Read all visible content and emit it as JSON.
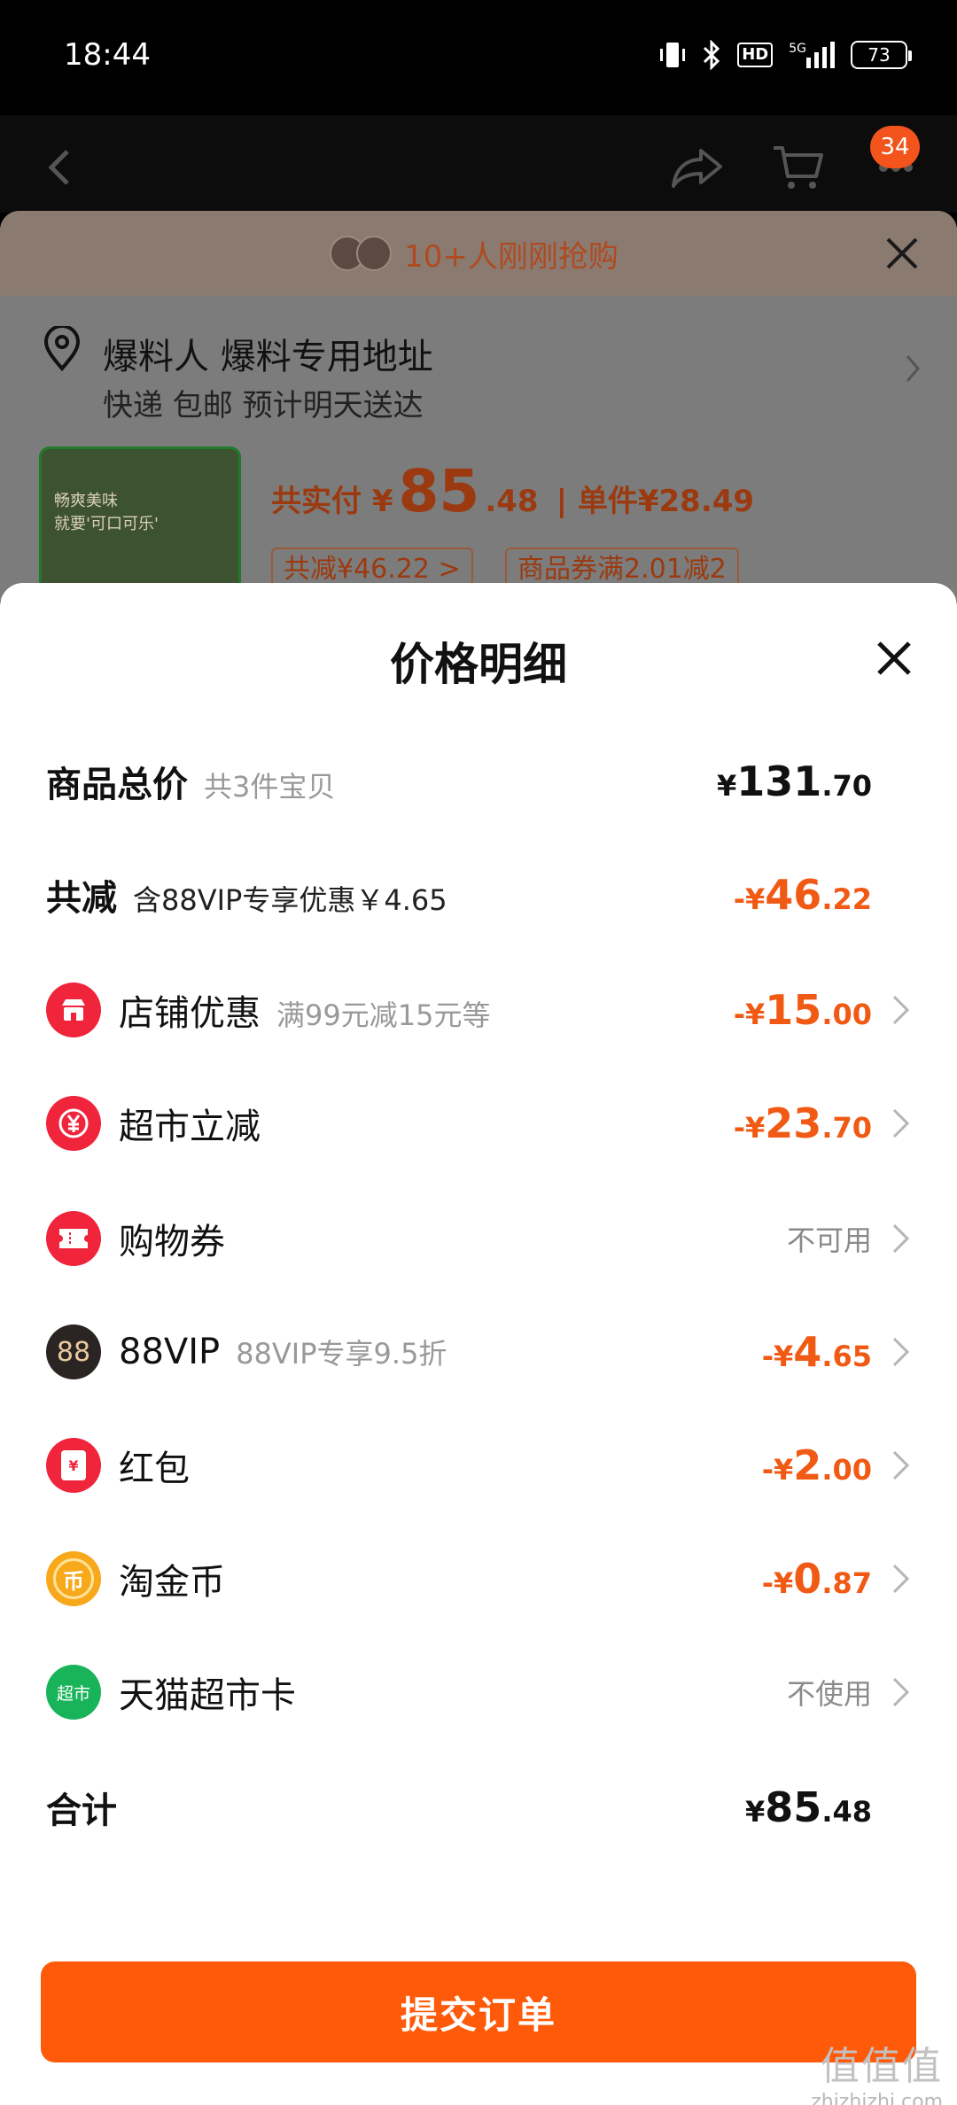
{
  "status_bar": {
    "time": "18:44",
    "network": "5G",
    "hd": "HD",
    "battery": "73"
  },
  "nav": {
    "cart_badge": "34"
  },
  "background_page": {
    "banner_text": "10+人刚刚抢购",
    "address_name": "爆料人 爆料专用地址",
    "shipping": "快递 包邮 预计明天送达",
    "paid_label": "共实付 ¥",
    "paid_int": "85",
    "paid_dec": ".48",
    "unit_price": "| 单件¥28.49",
    "chip_discount": "共减¥46.22 >",
    "chip_coupon": "商品券满2.01减2",
    "thumb_line1": "畅爽美味",
    "thumb_line2": "就要'可口可乐'"
  },
  "sheet": {
    "title": "价格明细",
    "total_goods": {
      "label": "商品总价",
      "sub": "共3件宝贝",
      "cur": "¥",
      "int": "131",
      "dec": ".70"
    },
    "total_reduce": {
      "label": "共减",
      "sub": "含88VIP专享优惠￥4.65",
      "cur": "-¥",
      "int": "46",
      "dec": ".22"
    },
    "items": [
      {
        "label": "店铺优惠",
        "sub": "满99元减15元等",
        "cur": "-¥",
        "int": "15",
        "dec": ".00",
        "icon": "store-icon",
        "color": "#f0243b"
      },
      {
        "label": "超市立减",
        "sub": "",
        "cur": "-¥",
        "int": "23",
        "dec": ".70",
        "icon": "yen-coupon-icon",
        "color": "#f0243b"
      },
      {
        "label": "购物券",
        "sub": "",
        "status": "不可用",
        "icon": "ticket-icon",
        "color": "#f0243b"
      },
      {
        "label": "88VIP",
        "sub": "88VIP专享9.5折",
        "cur": "-¥",
        "int": "4",
        "dec": ".65",
        "icon": "vip88-icon",
        "icon_text": "88",
        "color": "#2a2422"
      },
      {
        "label": "红包",
        "sub": "",
        "cur": "-¥",
        "int": "2",
        "dec": ".00",
        "icon": "red-packet-icon",
        "icon_text": "¥",
        "color": "#f0243b"
      },
      {
        "label": "淘金币",
        "sub": "",
        "cur": "-¥",
        "int": "0",
        "dec": ".87",
        "icon": "gold-coin-icon",
        "icon_text": "币",
        "color": "#f7a81b"
      },
      {
        "label": "天猫超市卡",
        "sub": "",
        "status": "不使用",
        "icon": "tmall-card-icon",
        "icon_text": "超市",
        "color": "#19b45a"
      }
    ],
    "sum": {
      "label": "合计",
      "cur": "¥",
      "int": "85",
      "dec": ".48"
    },
    "submit_label": "提交订单"
  },
  "watermark": {
    "big": "值值值",
    "small": "zhizhizhi.com"
  }
}
